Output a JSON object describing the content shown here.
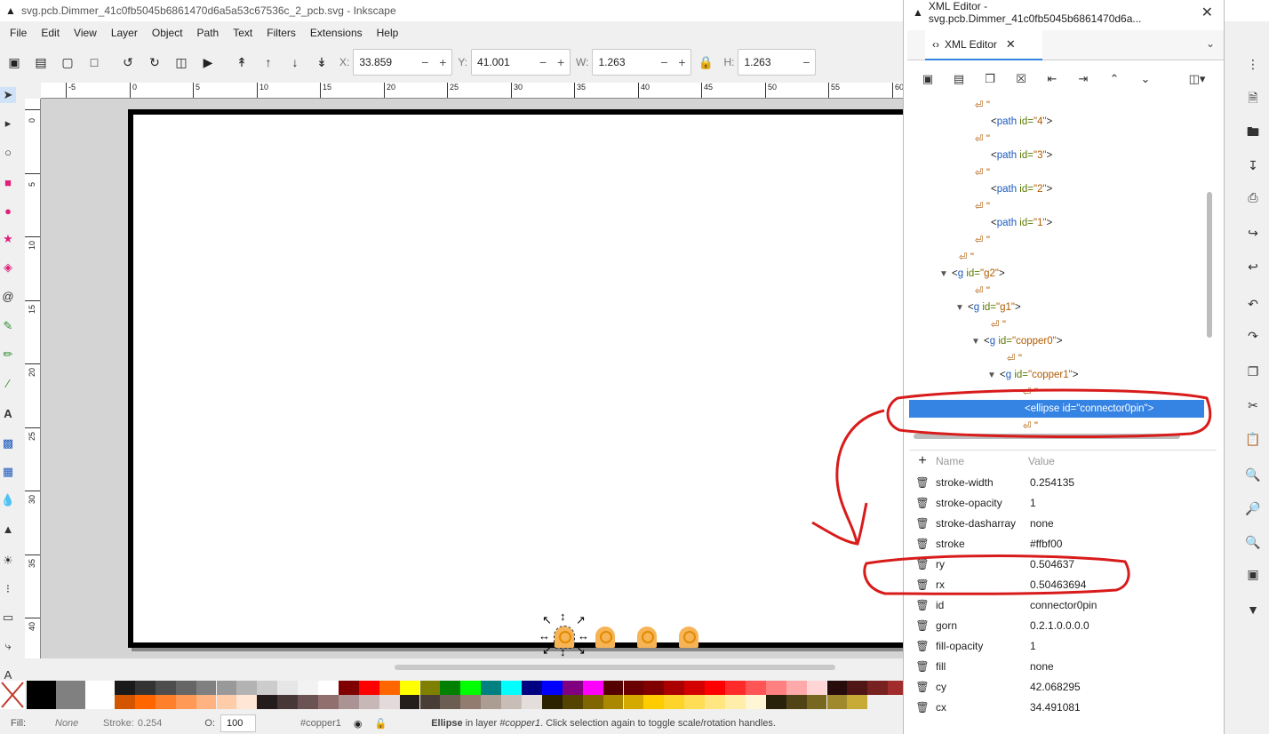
{
  "window": {
    "title": "svg.pcb.Dimmer_41c0fb5045b6861470d6a5a53c67536c_2_pcb.svg - Inkscape"
  },
  "menu": [
    "File",
    "Edit",
    "View",
    "Layer",
    "Object",
    "Path",
    "Text",
    "Filters",
    "Extensions",
    "Help"
  ],
  "toolbar": {
    "x_label": "X:",
    "x_value": "33.859",
    "y_label": "Y:",
    "y_value": "41.001",
    "w_label": "W:",
    "w_value": "1.263",
    "h_label": "H:",
    "h_value": "1.263"
  },
  "ruler": {
    "h_ticks": [
      "-5",
      "0",
      "5",
      "10",
      "15",
      "20",
      "25",
      "30",
      "35",
      "40",
      "45",
      "50",
      "55",
      "60"
    ],
    "v_ticks": [
      "0",
      "5",
      "10",
      "15",
      "20",
      "25",
      "30",
      "35",
      "40"
    ]
  },
  "statusbar": {
    "fill_label": "Fill:",
    "fill_value": "None",
    "stroke_label": "Stroke:",
    "stroke_value": "0.254",
    "opacity_label": "O:",
    "opacity_value": "100",
    "layer_name": "#copper1",
    "message_strong": "Ellipse",
    "message_mid": " in layer ",
    "message_layer": "#copper1",
    "message_rest": ". Click selection again to toggle scale/rotation handles."
  },
  "xml_editor": {
    "window_title": "XML Editor - svg.pcb.Dimmer_41c0fb5045b6861470d6a...",
    "tab_label": "XML Editor",
    "tree": [
      {
        "kind": "text",
        "text": "⏎      \""
      },
      {
        "kind": "node",
        "tag": "path",
        "attr": "id",
        "val": "4"
      },
      {
        "kind": "text",
        "text": "⏎      \""
      },
      {
        "kind": "node",
        "tag": "path",
        "attr": "id",
        "val": "3"
      },
      {
        "kind": "text",
        "text": "⏎      \""
      },
      {
        "kind": "node",
        "tag": "path",
        "attr": "id",
        "val": "2"
      },
      {
        "kind": "text",
        "text": "⏎      \""
      },
      {
        "kind": "node",
        "tag": "path",
        "attr": "id",
        "val": "1"
      },
      {
        "kind": "text",
        "text": "⏎    \""
      },
      {
        "kind": "text",
        "text": "⏎    \""
      },
      {
        "kind": "node",
        "tag": "g",
        "attr": "id",
        "val": "g2"
      },
      {
        "kind": "text",
        "text": "⏎      \""
      },
      {
        "kind": "node",
        "tag": "g",
        "attr": "id",
        "val": "g1"
      },
      {
        "kind": "text",
        "text": "⏎        \""
      },
      {
        "kind": "node",
        "tag": "g",
        "attr": "id",
        "val": "copper0"
      },
      {
        "kind": "text",
        "text": "⏎          \""
      },
      {
        "kind": "node",
        "tag": "g",
        "attr": "id",
        "val": "copper1"
      },
      {
        "kind": "text",
        "text": "⏎            \""
      },
      {
        "kind": "node",
        "tag": "ellipse",
        "attr": "id",
        "val": "connector0pin"
      },
      {
        "kind": "text",
        "text": "⏎            \""
      }
    ],
    "attr_header_name": "Name",
    "attr_header_value": "Value",
    "attributes": [
      {
        "name": "stroke-width",
        "value": "0.254135"
      },
      {
        "name": "stroke-opacity",
        "value": "1"
      },
      {
        "name": "stroke-dasharray",
        "value": "none"
      },
      {
        "name": "stroke",
        "value": "#ffbf00"
      },
      {
        "name": "ry",
        "value": "0.504637"
      },
      {
        "name": "rx",
        "value": "0.50463694"
      },
      {
        "name": "id",
        "value": "connector0pin"
      },
      {
        "name": "gorn",
        "value": "0.2.1.0.0.0.0"
      },
      {
        "name": "fill-opacity",
        "value": "1"
      },
      {
        "name": "fill",
        "value": "none"
      },
      {
        "name": "cy",
        "value": "42.068295"
      },
      {
        "name": "cx",
        "value": "34.491081"
      }
    ]
  },
  "palette": {
    "row1": [
      "#000000",
      "#808080",
      "#ffffff",
      "#1a1a1a",
      "#333333",
      "#4d4d4d",
      "#666666",
      "#808080",
      "#999999",
      "#b3b3b3",
      "#cccccc",
      "#e6e6e6",
      "#f2f2f2",
      "#ffffff",
      "#800000",
      "#ff0000",
      "#ff6600",
      "#ffff00",
      "#808000",
      "#008000",
      "#00ff00",
      "#008080",
      "#00ffff",
      "#000080",
      "#0000ff",
      "#800080",
      "#ff00ff",
      "#550000",
      "#6b0000",
      "#800000",
      "#aa0000",
      "#d40000",
      "#ff0000",
      "#ff2a2a",
      "#ff5555",
      "#ff8080",
      "#ffaaaa",
      "#ffd5d5",
      "#280b0b",
      "#501616",
      "#782121",
      "#a02c2c",
      "#c83737"
    ],
    "row2": [
      "#d45500",
      "#ff6600",
      "#ff7f2a",
      "#ff9955",
      "#ffb380",
      "#ffccaa",
      "#ffe6d5",
      "#241c1c",
      "#483737",
      "#6c5353",
      "#916f6f",
      "#ac9393",
      "#c8b7b7",
      "#e3dbdb",
      "#241f1c",
      "#483e37",
      "#6c5d53",
      "#917c6f",
      "#ac9d93",
      "#c8beb7",
      "#e3dedb",
      "#2b2200",
      "#554400",
      "#806600",
      "#aa8800",
      "#d4aa00",
      "#ffcc00",
      "#ffd42a",
      "#ffdd55",
      "#ffe680",
      "#ffeeaa",
      "#fff6d5",
      "#28220b",
      "#504416",
      "#786721",
      "#a0892c",
      "#c8ab37"
    ]
  },
  "colors": {
    "selection": "#3584e4",
    "annotation": "#d81b1b",
    "pin_fill": "#f7b456",
    "pin_stroke": "#ffbf00"
  }
}
